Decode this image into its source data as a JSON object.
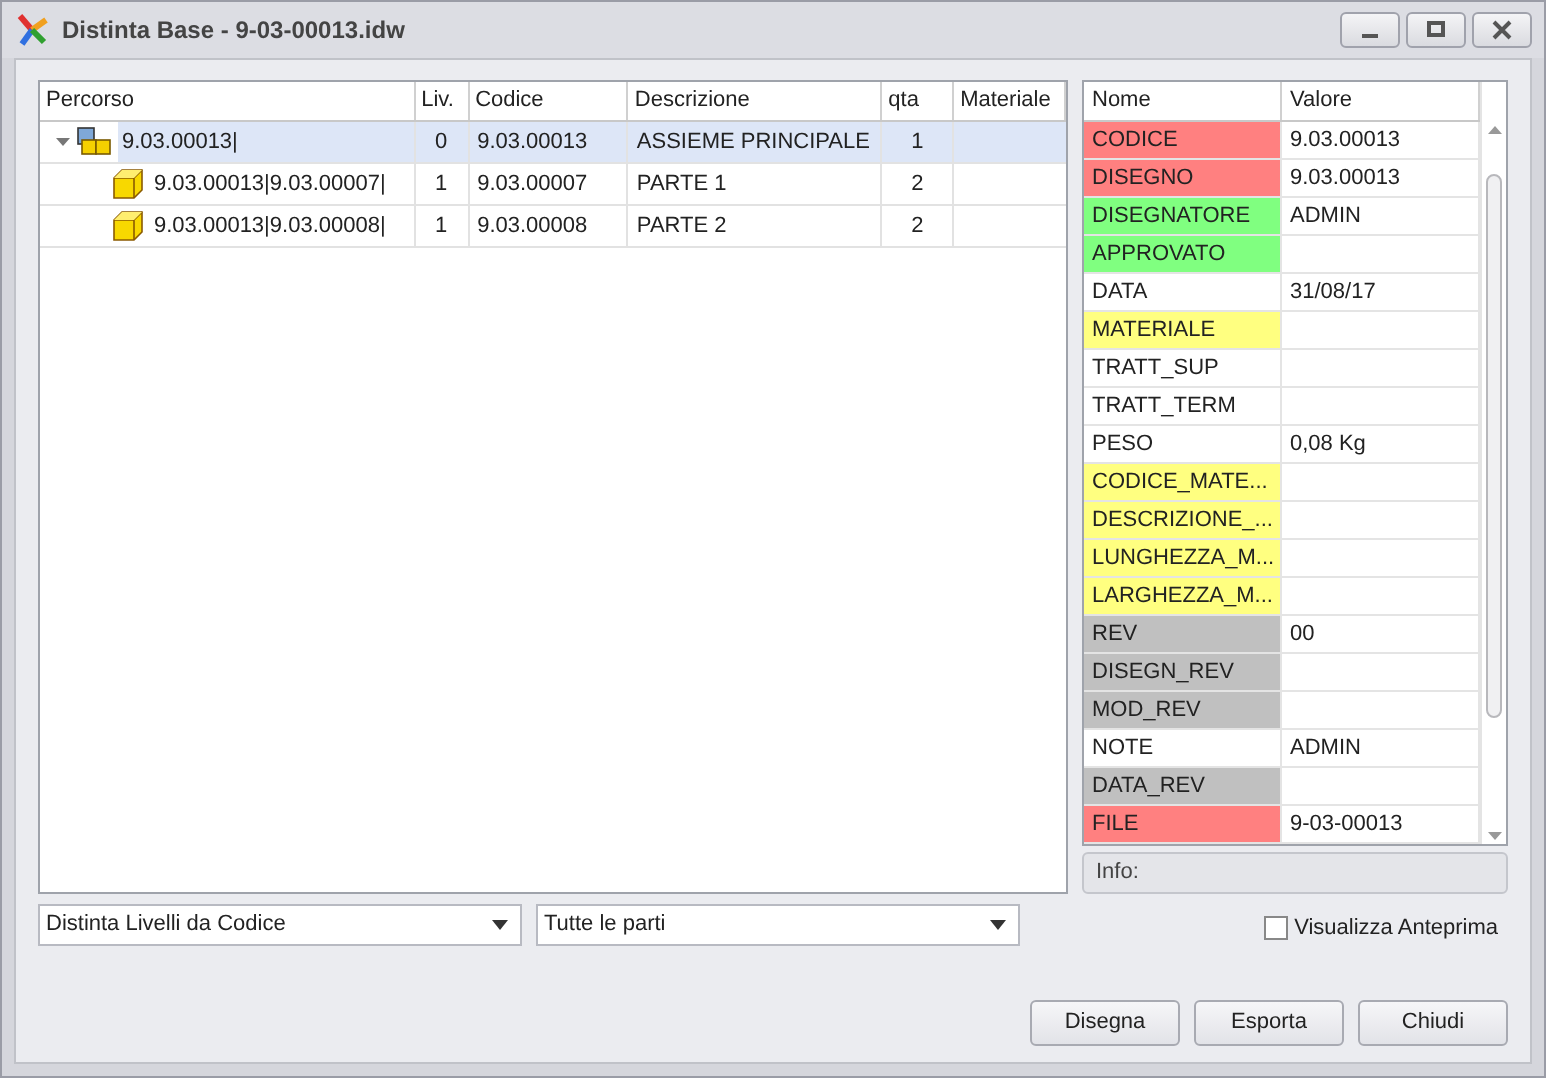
{
  "window": {
    "title": "Distinta Base - 9-03-00013.idw"
  },
  "tree": {
    "columns": [
      "Percorso",
      "Liv.",
      "Codice",
      "Descrizione",
      "qta",
      "Materiale"
    ],
    "rows": [
      {
        "kind": "assembly",
        "expanded": true,
        "selected": true,
        "path": "9.03.00013|",
        "level": "0",
        "code": "9.03.00013",
        "description": "ASSIEME PRINCIPALE",
        "qty": "1",
        "children": [
          {
            "kind": "part",
            "selected": false,
            "path": "9.03.00013|9.03.00007|",
            "level": "1",
            "code": "9.03.00007",
            "description": "PARTE 1",
            "qty": "2"
          },
          {
            "kind": "part",
            "selected": false,
            "path": "9.03.00013|9.03.00008|",
            "level": "1",
            "code": "9.03.00008",
            "description": "PARTE 2",
            "qty": "2"
          }
        ]
      }
    ]
  },
  "properties": {
    "columns": [
      "Nome",
      "Valore"
    ],
    "rows": [
      {
        "name": "CODICE",
        "value": "9.03.00013",
        "color": "#ff8080"
      },
      {
        "name": "DISEGNO",
        "value": "9.03.00013",
        "color": "#ff8080"
      },
      {
        "name": "DISEGNATORE",
        "value": "ADMIN",
        "color": "#80ff80"
      },
      {
        "name": "APPROVATO",
        "color": "#80ff80"
      },
      {
        "name": "DATA",
        "value": "31/08/17",
        "color": "#ffffff"
      },
      {
        "name": "MATERIALE",
        "color": "#ffff80"
      },
      {
        "name": "TRATT_SUP",
        "color": "#ffffff"
      },
      {
        "name": "TRATT_TERM",
        "color": "#ffffff"
      },
      {
        "name": "PESO",
        "value": "0,08 Kg",
        "color": "#ffffff"
      },
      {
        "name": "CODICE_MATE...",
        "color": "#ffff80"
      },
      {
        "name": "DESCRIZIONE_...",
        "color": "#ffff80"
      },
      {
        "name": "LUNGHEZZA_M...",
        "color": "#ffff80"
      },
      {
        "name": "LARGHEZZA_M...",
        "color": "#ffff80"
      },
      {
        "name": "REV",
        "value": "00",
        "color": "#c0c0c0"
      },
      {
        "name": "DISEGN_REV",
        "color": "#c0c0c0"
      },
      {
        "name": "MOD_REV",
        "color": "#c0c0c0"
      },
      {
        "name": "NOTE",
        "value": "ADMIN",
        "color": "#ffffff"
      },
      {
        "name": "DATA_REV",
        "color": "#c0c0c0"
      },
      {
        "name": "FILE",
        "value": "9-03-00013",
        "color": "#ff8080"
      }
    ]
  },
  "info": {
    "label": "Info:"
  },
  "dropdowns": [
    {
      "value": "Distinta Livelli da Codice"
    },
    {
      "value": "Tutte le parti"
    }
  ],
  "preview_checkbox": {
    "label": "Visualizza Anteprima",
    "checked": false
  },
  "buttons": [
    "Disegna",
    "Esporta",
    "Chiudi"
  ]
}
